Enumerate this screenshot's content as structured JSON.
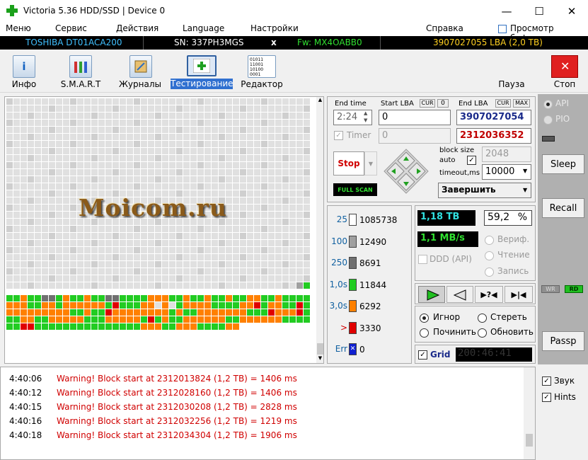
{
  "window": {
    "title": "Victoria 5.36 HDD/SSD | Device 0",
    "minimize": "—",
    "maximize": "☐",
    "close": "✕"
  },
  "menu": {
    "items": [
      "Меню",
      "Сервис",
      "Действия",
      "Language",
      "Настройки"
    ],
    "help": "Справка",
    "clipboard": "Просмотр буфера"
  },
  "drive": {
    "model": "TOSHIBA DT01ACA200",
    "serial": "SN: 337PH3MGS",
    "close": "x",
    "firmware": "Fw: MX4OABB0",
    "lba": "3907027055 LBA (2,0 TB)"
  },
  "toolbar": {
    "info": "Инфо",
    "smart": "S.M.A.R.T",
    "journals": "Журналы",
    "testing": "Тестирование",
    "editor": "Редактор",
    "pause": "Пауза",
    "stop": "Стоп"
  },
  "scan": {
    "end_time_label": "End time",
    "end_time": "2:24",
    "start_lba_label": "Start LBA",
    "cur": "CUR",
    "zero": "0",
    "start_lba": "0",
    "end_lba_label": "End LBA",
    "cur2": "CUR",
    "max": "MAX",
    "end_lba": "3907027054",
    "timer_label": "Timer",
    "timer_value": "0",
    "current_lba": "2312036352",
    "block_size_label": "block size",
    "auto_label": "auto",
    "block_size": "2048",
    "timeout_label": "timeout,ms",
    "timeout": "10000",
    "stop_button": "Stop",
    "full_scan": "FULL SCAN",
    "finish_select": "Завершить"
  },
  "stats": {
    "buckets": [
      {
        "label": "25",
        "color": "#ffffff",
        "count": "1085738"
      },
      {
        "label": "100",
        "color": "#a0a0a0",
        "count": "12490"
      },
      {
        "label": "250",
        "color": "#707070",
        "count": "8691"
      },
      {
        "label": "1,0s",
        "color": "#22cc22",
        "count": "11844"
      },
      {
        "label": "3,0s",
        "color": "#ff8000",
        "count": "6292"
      },
      {
        "label": ">",
        "color": "#e00000",
        "count": "3330"
      },
      {
        "label": "Err",
        "color": "#1020d0",
        "count": "0"
      }
    ],
    "bucket_label_colors": [
      "#1060a0",
      "#1060a0",
      "#1060a0",
      "#1060a0",
      "#1060a0",
      "#d00000",
      "#1060a0"
    ],
    "position": "1,18 TB",
    "percent": "59,2",
    "percent_sign": "%",
    "speed": "1,1 MB/s",
    "verify": "Вериф.",
    "read": "Чтение",
    "write": "Запись",
    "ddd": "DDD (API)"
  },
  "actions": {
    "ignore": "Игнор",
    "erase": "Стереть",
    "repair": "Починить",
    "refresh": "Обновить",
    "grid": "Grid",
    "elapsed": "200:46:41"
  },
  "side": {
    "api": "API",
    "pio": "PIO",
    "sleep": "Sleep",
    "recall": "Recall",
    "wr": "WR",
    "rd": "RD",
    "passp": "Passp"
  },
  "log": [
    {
      "time": "4:40:06",
      "msg": "Warning! Block start at 2312013824 (1,2 TB)  = 1406 ms"
    },
    {
      "time": "4:40:12",
      "msg": "Warning! Block start at 2312028160 (1,2 TB)  = 1406 ms"
    },
    {
      "time": "4:40:15",
      "msg": "Warning! Block start at 2312030208 (1,2 TB)  = 2828 ms"
    },
    {
      "time": "4:40:16",
      "msg": "Warning! Block start at 2312032256 (1,2 TB)  = 1219 ms"
    },
    {
      "time": "4:40:18",
      "msg": "Warning! Block start at 2312034304 (1,2 TB)  = 1906 ms"
    }
  ],
  "options": {
    "sound": "Звук",
    "hints": "Hints"
  },
  "watermark": "Moicom.ru"
}
